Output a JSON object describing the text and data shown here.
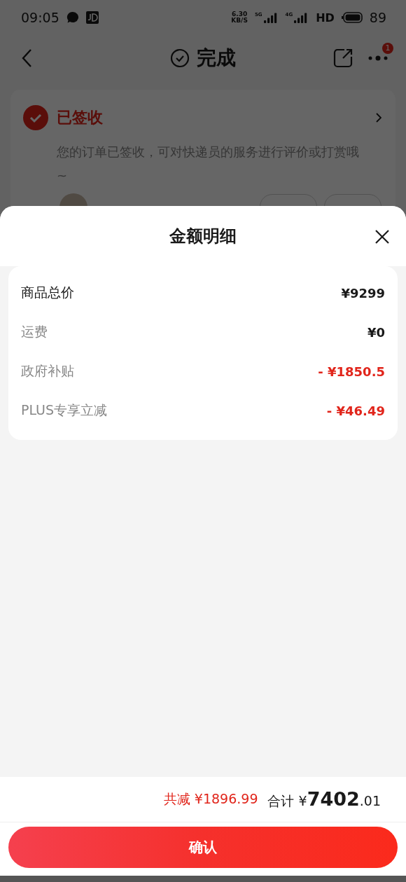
{
  "status_bar": {
    "time": "09:05",
    "speed_value": "6.30",
    "speed_unit": "KB/S",
    "net_1": "5G",
    "net_2": "4G",
    "hd": "HD",
    "battery": "89"
  },
  "nav": {
    "title": "完成",
    "badge": "1"
  },
  "tracking": {
    "status": "已签收",
    "message": "您的订单已签收，可对快递员的服务进行评价或打赏哦~"
  },
  "sheet": {
    "title": "金额明细",
    "rows": [
      {
        "kind": "subtotal",
        "label": "商品总价",
        "amount": "¥9299"
      },
      {
        "kind": "fee",
        "label": "运费",
        "amount": "¥0"
      },
      {
        "kind": "discount",
        "label": "政府补贴",
        "amount": "- ¥1850.5"
      },
      {
        "kind": "discount",
        "label": "PLUS专享立减",
        "amount": "- ¥46.49"
      }
    ],
    "savings": {
      "label": "共减",
      "amount": "¥1896.99"
    },
    "total": {
      "label": "合计",
      "currency": "¥",
      "integer": "7402",
      "decimal": ".01"
    },
    "confirm": "确认"
  }
}
